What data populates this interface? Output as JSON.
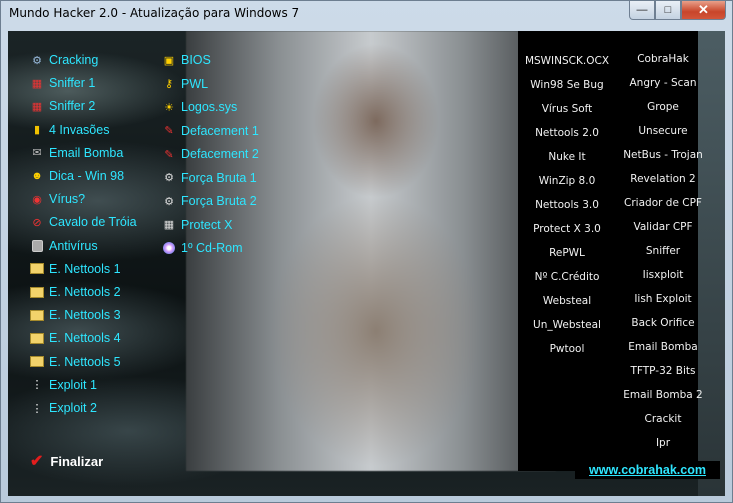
{
  "window": {
    "title": "Mundo Hacker 2.0 - Atualização para Windows 7"
  },
  "left_menu": [
    {
      "label": "Cracking",
      "icon": "tools-icon"
    },
    {
      "label": "Sniffer 1",
      "icon": "network-icon"
    },
    {
      "label": "Sniffer 2",
      "icon": "network-icon"
    },
    {
      "label": "4 Invasões",
      "icon": "file-icon"
    },
    {
      "label": "Email Bomba",
      "icon": "email-icon"
    },
    {
      "label": "Dica - Win 98",
      "icon": "smiley-icon"
    },
    {
      "label": "Vírus?",
      "icon": "search-icon"
    },
    {
      "label": "Cavalo de Tróia",
      "icon": "no-entry-icon"
    },
    {
      "label": "Antivírus",
      "icon": "lock-icon"
    },
    {
      "label": "E. Nettools 1",
      "icon": "folder-icon"
    },
    {
      "label": "E. Nettools 2",
      "icon": "folder-icon"
    },
    {
      "label": "E. Nettools 3",
      "icon": "folder-icon"
    },
    {
      "label": "E. Nettools 4",
      "icon": "folder-icon"
    },
    {
      "label": "E. Nettools 5",
      "icon": "folder-icon"
    },
    {
      "label": "Exploit 1",
      "icon": "sparkle-icon"
    },
    {
      "label": "Exploit 2",
      "icon": "sparkle-icon"
    }
  ],
  "mid_menu": [
    {
      "label": "BIOS",
      "icon": "chip-icon"
    },
    {
      "label": "PWL",
      "icon": "key-icon"
    },
    {
      "label": "Logos.sys",
      "icon": "sun-icon"
    },
    {
      "label": "Defacement 1",
      "icon": "brush-icon"
    },
    {
      "label": "Defacement 2",
      "icon": "brush-icon"
    },
    {
      "label": "Força Bruta 1",
      "icon": "gear-icon"
    },
    {
      "label": "Força Bruta 2",
      "icon": "gear-icon"
    },
    {
      "label": "Protect X",
      "icon": "computer-icon"
    },
    {
      "label": "1º Cd-Rom",
      "icon": "cd-icon"
    }
  ],
  "right_col1": [
    "MSWINSCK.OCX",
    "Win98 Se Bug",
    "Vírus Soft",
    "Nettools 2.0",
    "Nuke It",
    "WinZip 8.0",
    "Nettools 3.0",
    "Protect X 3.0",
    "RePWL",
    "Nº C.Crédito",
    "Websteal",
    "Un_Websteal",
    "Pwtool"
  ],
  "right_col2": [
    "CobraHak",
    "Angry - Scan",
    "Grope",
    "Unsecure",
    "NetBus - Trojan",
    "Revelation 2",
    "Criador de CPF",
    "Validar CPF",
    "Sniffer",
    "Iisxploit",
    "Iish Exploit",
    "Back Orifice",
    "Email Bomba",
    "TFTP-32 Bits",
    "Email Bomba 2",
    "Crackit",
    "Ipr"
  ],
  "finalizar": {
    "label": "Finalizar",
    "icon": "checkmark-icon"
  },
  "website_link": "www.cobrahak.com",
  "colors": {
    "link_text": "#2ee6ff",
    "background": "#000000",
    "close_button": "#c8452a"
  }
}
